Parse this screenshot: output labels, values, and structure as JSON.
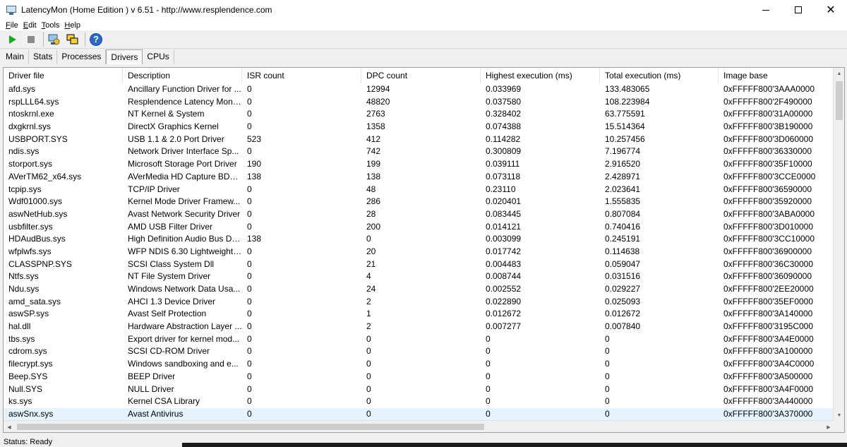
{
  "window": {
    "title": "LatencyMon  (Home Edition )  v 6.51 - http://www.resplendence.com"
  },
  "menu": [
    {
      "hotkey": "F",
      "rest": "ile"
    },
    {
      "hotkey": "E",
      "rest": "dit"
    },
    {
      "hotkey": "T",
      "rest": "ools"
    },
    {
      "hotkey": "H",
      "rest": "elp"
    }
  ],
  "toolbar": {
    "icons": [
      "play-icon",
      "stop-icon",
      "process-icon",
      "windows-icon",
      "help-icon"
    ],
    "help_glyph": "?"
  },
  "tabs": [
    "Main",
    "Stats",
    "Processes",
    "Drivers",
    "CPUs"
  ],
  "active_tab": "Drivers",
  "columns": [
    "Driver file",
    "Description",
    "ISR count",
    "DPC count",
    "Highest execution (ms)",
    "Total execution (ms)",
    "Image base"
  ],
  "rows": [
    [
      "afd.sys",
      "Ancillary Function Driver for ...",
      "0",
      "12994",
      "0.033969",
      "133.483065",
      "0xFFFFF800'3AAA0000"
    ],
    [
      "rspLLL64.sys",
      "Resplendence Latency Monit...",
      "0",
      "48820",
      "0.037580",
      "108.223984",
      "0xFFFFF800'2F490000"
    ],
    [
      "ntoskrnl.exe",
      "NT Kernel & System",
      "0",
      "2763",
      "0.328402",
      "63.775591",
      "0xFFFFF800'31A00000"
    ],
    [
      "dxgkrnl.sys",
      "DirectX Graphics Kernel",
      "0",
      "1358",
      "0.074388",
      "15.514364",
      "0xFFFFF800'3B190000"
    ],
    [
      "USBPORT.SYS",
      "USB 1.1 & 2.0 Port Driver",
      "523",
      "412",
      "0.114282",
      "10.257456",
      "0xFFFFF800'3D060000"
    ],
    [
      "ndis.sys",
      "Network Driver Interface Sp...",
      "0",
      "742",
      "0.300809",
      "7.196774",
      "0xFFFFF800'36330000"
    ],
    [
      "storport.sys",
      "Microsoft Storage Port Driver",
      "190",
      "199",
      "0.039111",
      "2.916520",
      "0xFFFFF800'35F10000"
    ],
    [
      "AVerTM62_x64.sys",
      "AVerMedia HD Capture BDA ...",
      "138",
      "138",
      "0.073118",
      "2.428971",
      "0xFFFFF800'3CCE0000"
    ],
    [
      "tcpip.sys",
      "TCP/IP Driver",
      "0",
      "48",
      "0.23110",
      "2.023641",
      "0xFFFFF800'36590000"
    ],
    [
      "Wdf01000.sys",
      "Kernel Mode Driver Framew...",
      "0",
      "286",
      "0.020401",
      "1.555835",
      "0xFFFFF800'35920000"
    ],
    [
      "aswNetHub.sys",
      "Avast Network Security Driver",
      "0",
      "28",
      "0.083445",
      "0.807084",
      "0xFFFFF800'3ABA0000"
    ],
    [
      "usbfilter.sys",
      "AMD USB Filter Driver",
      "0",
      "200",
      "0.014121",
      "0.740416",
      "0xFFFFF800'3D010000"
    ],
    [
      "HDAudBus.sys",
      "High Definition Audio Bus Dri...",
      "138",
      "0",
      "0.003099",
      "0.245191",
      "0xFFFFF800'3CC10000"
    ],
    [
      "wfplwfs.sys",
      "WFP NDIS 6.30 Lightweight ...",
      "0",
      "20",
      "0.017742",
      "0.114638",
      "0xFFFFF800'36900000"
    ],
    [
      "CLASSPNP.SYS",
      "SCSI Class System Dll",
      "0",
      "21",
      "0.004483",
      "0.059047",
      "0xFFFFF800'36C30000"
    ],
    [
      "Ntfs.sys",
      "NT File System Driver",
      "0",
      "4",
      "0.008744",
      "0.031516",
      "0xFFFFF800'36090000"
    ],
    [
      "Ndu.sys",
      "Windows Network Data Usa...",
      "0",
      "24",
      "0.002552",
      "0.029227",
      "0xFFFFF800'2EE20000"
    ],
    [
      "amd_sata.sys",
      "AHCI 1.3 Device Driver",
      "0",
      "2",
      "0.022890",
      "0.025093",
      "0xFFFFF800'35EF0000"
    ],
    [
      "aswSP.sys",
      "Avast Self Protection",
      "0",
      "1",
      "0.012672",
      "0.012672",
      "0xFFFFF800'3A140000"
    ],
    [
      "hal.dll",
      "Hardware Abstraction Layer ...",
      "0",
      "2",
      "0.007277",
      "0.007840",
      "0xFFFFF800'3195C000"
    ],
    [
      "tbs.sys",
      "Export driver for kernel mod...",
      "0",
      "0",
      "0",
      "0",
      "0xFFFFF800'3A4E0000"
    ],
    [
      "cdrom.sys",
      "SCSI CD-ROM Driver",
      "0",
      "0",
      "0",
      "0",
      "0xFFFFF800'3A100000"
    ],
    [
      "filecrypt.sys",
      "Windows sandboxing and e...",
      "0",
      "0",
      "0",
      "0",
      "0xFFFFF800'3A4C0000"
    ],
    [
      "Beep.SYS",
      "BEEP Driver",
      "0",
      "0",
      "0",
      "0",
      "0xFFFFF800'3A500000"
    ],
    [
      "Null.SYS",
      "NULL Driver",
      "0",
      "0",
      "0",
      "0",
      "0xFFFFF800'3A4F0000"
    ],
    [
      "ks.sys",
      "Kernel CSA Library",
      "0",
      "0",
      "0",
      "0",
      "0xFFFFF800'3A440000"
    ],
    [
      "aswSnx.sys",
      "Avast Antivirus",
      "0",
      "0",
      "0",
      "0",
      "0xFFFFF800'3A370000"
    ]
  ],
  "selected_row": 26,
  "status": "Status: Ready"
}
